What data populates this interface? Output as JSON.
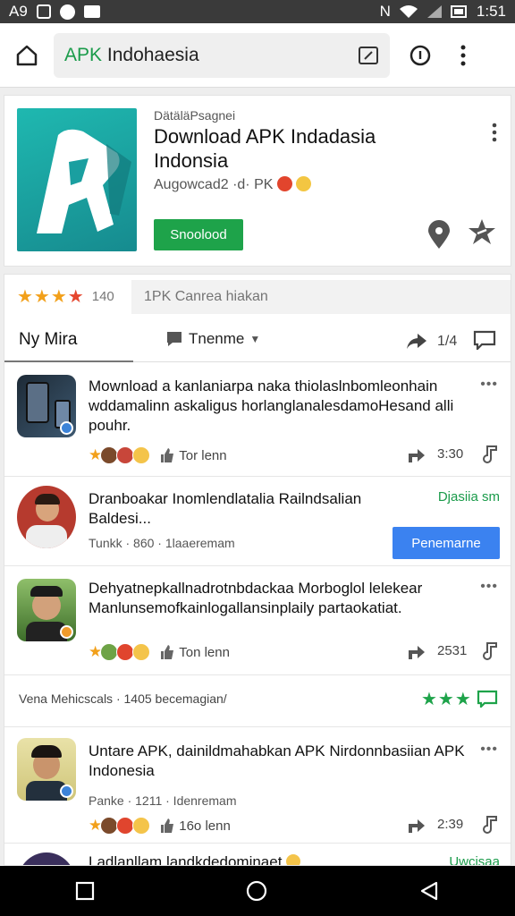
{
  "status_bar": {
    "left_label": "A9",
    "time": "1:51",
    "badge": "N"
  },
  "url_bar": {
    "url_prefix": "APK",
    "url_text": "Indohaesia"
  },
  "app": {
    "developer": "DätäläPsagnei",
    "title": "Download APK Indadasia Indonsia",
    "subtitle": "Augowcad2 ·d· PK",
    "install_label": "Snoolood"
  },
  "feed": {
    "rating_count": "140",
    "comment_placeholder": "1PK Canrea hiakan",
    "tab_1": "Ny Mira",
    "tab_2": "Tnenme",
    "share_count": "1/4"
  },
  "posts": [
    {
      "text": "Mownload a kanlaniarpa naka thiolaslnbomleonhain wddamalinn askaligus horlanglanalesdamoHesand alli pouhr.",
      "like_label": "Tor lenn",
      "share_count": "3:30"
    },
    {
      "text": "Dranboakar Inomlendlatalia Railndsalian Baldesi...",
      "side_label": "Djasiia sm",
      "meta": "Tunkk · 860 · 1laaeremam",
      "button_label": "Penemarne"
    },
    {
      "text": "Dehyatnepkallnadrotnbdackaa Morboglol lelekear Manlunsemofkainlogallansinplaily partaokatiat.",
      "like_label": "Ton lenn",
      "share_count": "2531"
    }
  ],
  "section": {
    "text": "Vena Mehicscals · 1405 becemagian/"
  },
  "posts2": [
    {
      "text": "Untare APK, dainildmahabkan APK Nirdonnbasiian APK Indonesia",
      "meta": "Panke · 1211 · Idenremam",
      "like_label": "16o lenn",
      "share_count": "2:39"
    },
    {
      "text": "Ladlanllam landkdedominaet",
      "side_label": "Uwcisaa"
    }
  ],
  "colors": {
    "accent_green": "#1ea34a",
    "button_blue": "#3b82f0",
    "star_gold": "#f2a01a",
    "app_teal": "#1fb8b0"
  }
}
